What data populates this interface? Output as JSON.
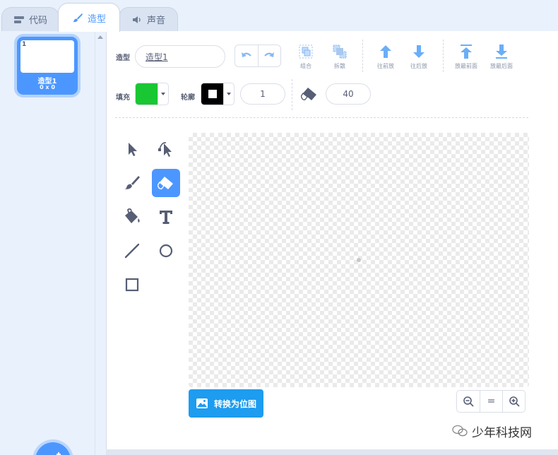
{
  "tabs": [
    {
      "label": "代码",
      "icon": "code-icon"
    },
    {
      "label": "造型",
      "icon": "brush-icon",
      "active": true
    },
    {
      "label": "声音",
      "icon": "speaker-icon"
    }
  ],
  "costume_list": {
    "items": [
      {
        "index": "1",
        "name": "造型1",
        "size": "0 x 0",
        "selected": true
      }
    ],
    "add_button_icon": "add-costume-icon"
  },
  "toolbar": {
    "costume_label": "造型",
    "costume_name": "造型1",
    "undo_icon": "undo-icon",
    "redo_icon": "redo-icon",
    "group_label": "组合",
    "ungroup_label": "拆散",
    "forward_label": "往前放",
    "backward_label": "往后放",
    "front_label": "放最前面",
    "back_label": "放最后面"
  },
  "style_bar": {
    "fill_label": "填充",
    "fill_color": "#19c732",
    "outline_label": "轮廓",
    "outline_color": "#000000",
    "outline_width": "1",
    "eraser_size": "40"
  },
  "tools": [
    {
      "name": "select",
      "icon": "select-icon"
    },
    {
      "name": "reshape",
      "icon": "reshape-icon"
    },
    {
      "name": "brush",
      "icon": "brush-icon"
    },
    {
      "name": "eraser",
      "icon": "eraser-icon",
      "active": true
    },
    {
      "name": "fill",
      "icon": "fill-icon"
    },
    {
      "name": "text",
      "icon": "text-icon"
    },
    {
      "name": "line",
      "icon": "line-icon"
    },
    {
      "name": "circle",
      "icon": "circle-icon"
    },
    {
      "name": "rectangle",
      "icon": "rectangle-icon"
    }
  ],
  "canvas": {
    "convert_label": "转换为位图"
  },
  "zoom": {
    "zoom_out": "zoom-out-icon",
    "reset": "=",
    "zoom_in": "zoom-in-icon"
  },
  "watermark": {
    "text": "少年科技网"
  },
  "colors": {
    "accent": "#4c97ff",
    "convert_button": "#1d9cf0"
  }
}
